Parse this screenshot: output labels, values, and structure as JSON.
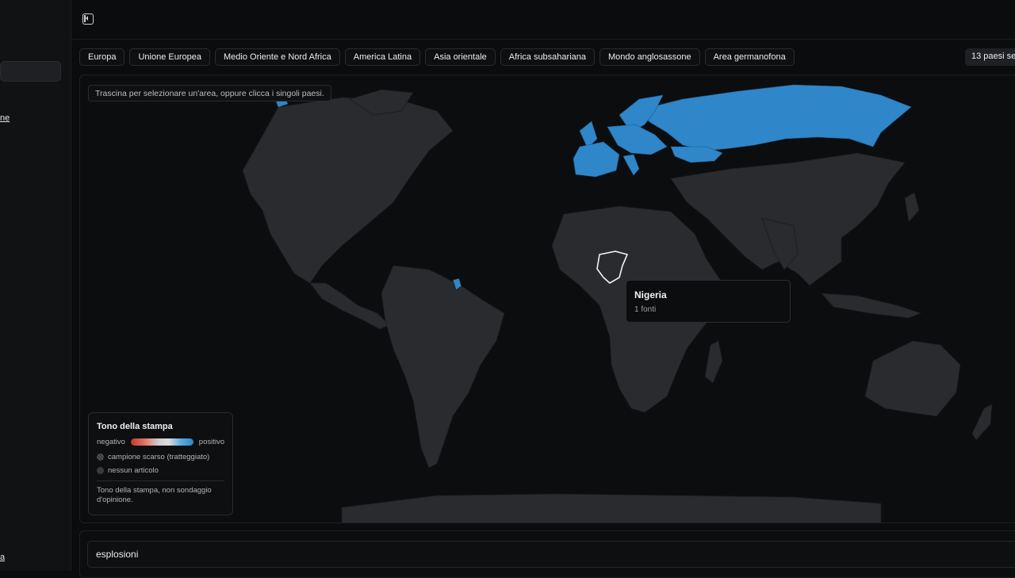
{
  "sidebar": {
    "link_top": "ne",
    "link_bottom": "a"
  },
  "toolbar": {
    "collapse_icon": "sidebar-collapse-icon"
  },
  "region_chips": [
    "Europa",
    "Unione Europea",
    "Medio Oriente e Nord Africa",
    "America Latina",
    "Asia orientale",
    "Africa subsahariana",
    "Mondo anglosassone",
    "Area germanofona"
  ],
  "selected_count": "13 paesi sele",
  "map": {
    "hint": "Trascina per selezionare un'area, oppure clicca i singoli paesi.",
    "selected_color": "#2f86c9",
    "land_color": "#2a2b2e",
    "tooltip": {
      "country": "Nigeria",
      "sources": "1 fonti"
    }
  },
  "legend": {
    "title": "Tono della stampa",
    "negative": "negativo",
    "positive": "positivo",
    "sparse": "campione scarso (tratteggiato)",
    "none": "nessun articolo",
    "note": "Tono della stampa, non sondaggio d'opinione.",
    "negative_color": "#c0392b",
    "positive_color": "#2f86c9"
  },
  "search": {
    "value": "esplosioni"
  }
}
